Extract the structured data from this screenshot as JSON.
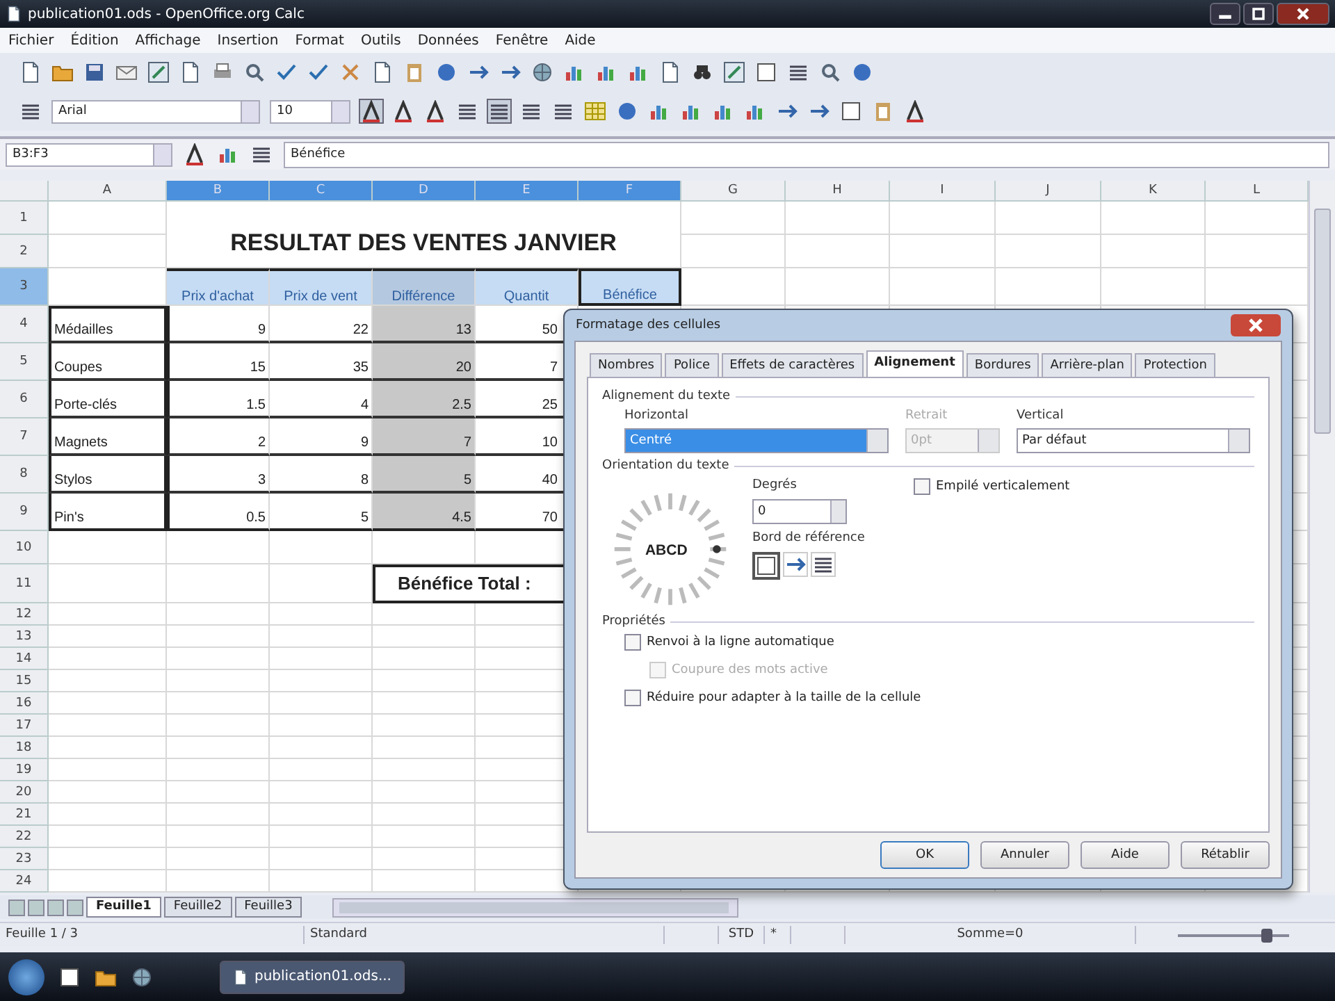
{
  "window": {
    "title": "publication01.ods - OpenOffice.org Calc"
  },
  "menu": [
    "Fichier",
    "Édition",
    "Affichage",
    "Insertion",
    "Format",
    "Outils",
    "Données",
    "Fenêtre",
    "Aide"
  ],
  "format_bar": {
    "font": "Arial",
    "size": "10",
    "bold": true,
    "align_center": true
  },
  "formula_bar": {
    "name_box": "B3:F3",
    "content": "Bénéfice"
  },
  "sheet": {
    "columns": [
      {
        "label": "A",
        "selected": false
      },
      {
        "label": "B",
        "selected": true
      },
      {
        "label": "C",
        "selected": true
      },
      {
        "label": "D",
        "selected": true
      },
      {
        "label": "E",
        "selected": true
      },
      {
        "label": "F",
        "selected": true
      },
      {
        "label": "G",
        "selected": false
      },
      {
        "label": "H",
        "selected": false
      },
      {
        "label": "I",
        "selected": false
      },
      {
        "label": "J",
        "selected": false
      },
      {
        "label": "K",
        "selected": false
      },
      {
        "label": "L",
        "selected": false
      }
    ],
    "rows": [
      {
        "label": "1",
        "selected": false
      },
      {
        "label": "2",
        "selected": false
      },
      {
        "label": "3",
        "selected": true
      },
      {
        "label": "4",
        "selected": false
      },
      {
        "label": "5",
        "selected": false
      },
      {
        "label": "6",
        "selected": false
      },
      {
        "label": "7",
        "selected": false
      },
      {
        "label": "8",
        "selected": false
      },
      {
        "label": "9",
        "selected": false
      },
      {
        "label": "10",
        "selected": false
      },
      {
        "label": "11",
        "selected": false
      },
      {
        "label": "12",
        "selected": false
      },
      {
        "label": "13",
        "selected": false
      },
      {
        "label": "14",
        "selected": false
      },
      {
        "label": "15",
        "selected": false
      },
      {
        "label": "16",
        "selected": false
      },
      {
        "label": "17",
        "selected": false
      },
      {
        "label": "18",
        "selected": false
      },
      {
        "label": "19",
        "selected": false
      },
      {
        "label": "20",
        "selected": false
      },
      {
        "label": "21",
        "selected": false
      },
      {
        "label": "22",
        "selected": false
      },
      {
        "label": "23",
        "selected": false
      },
      {
        "label": "24",
        "selected": false
      }
    ],
    "title": "RESULTAT DES VENTES JANVIER",
    "headers": [
      "Prix d'achat",
      "Prix de vent",
      "Différence",
      "Quantit",
      "Bénéfice"
    ],
    "items": [
      {
        "name": "Médailles",
        "values": [
          "9",
          "22",
          "13",
          "50"
        ]
      },
      {
        "name": "Coupes",
        "values": [
          "15",
          "35",
          "20",
          "7"
        ]
      },
      {
        "name": "Porte-clés",
        "values": [
          "1.5",
          "4",
          "2.5",
          "25"
        ]
      },
      {
        "name": "Magnets",
        "values": [
          "2",
          "9",
          "7",
          "10"
        ]
      },
      {
        "name": "Stylos",
        "values": [
          "3",
          "8",
          "5",
          "40"
        ]
      },
      {
        "name": "Pin's",
        "values": [
          "0.5",
          "5",
          "4.5",
          "70"
        ]
      }
    ],
    "total_label": "Bénéfice Total :"
  },
  "sheet_tabs": [
    {
      "label": "Feuille1",
      "selected": true
    },
    {
      "label": "Feuille2",
      "selected": false
    },
    {
      "label": "Feuille3",
      "selected": false
    }
  ],
  "status_bar": {
    "sheet": "Feuille 1 / 3",
    "style": "Standard",
    "mode": "STD",
    "modified": "*",
    "sum": "Somme=0",
    "zoom": {
      "level": 0.8
    }
  },
  "taskbar": {
    "tasks": [
      {
        "label": "publication01.ods...",
        "selected": true
      }
    ]
  },
  "dialog": {
    "title": "Formatage des cellules",
    "tabs": [
      {
        "label": "Nombres",
        "selected": false
      },
      {
        "label": "Police",
        "selected": false
      },
      {
        "label": "Effets de caractères",
        "selected": false
      },
      {
        "label": "Alignement",
        "selected": true
      },
      {
        "label": "Bordures",
        "selected": false
      },
      {
        "label": "Arrière-plan",
        "selected": false
      },
      {
        "label": "Protection",
        "selected": false
      }
    ],
    "alignment_section": "Alignement du texte",
    "horizontal": {
      "label": "Horizontal",
      "value": "Centré"
    },
    "indent": {
      "label": "Retrait",
      "value": "0pt",
      "disabled": true
    },
    "vertical": {
      "label": "Vertical",
      "value": "Par défaut"
    },
    "orientation_section": "Orientation du texte",
    "dial_text": "ABCD",
    "degrees": {
      "label": "Degrés",
      "value": "0"
    },
    "reference_edge": {
      "label": "Bord de référence",
      "options": [
        {
          "selected": true
        },
        {
          "selected": false
        },
        {
          "selected": false
        }
      ]
    },
    "stacked": {
      "label": "Empilé verticalement",
      "checked": false,
      "disabled": false
    },
    "properties_section": "Propriétés",
    "properties": [
      {
        "label": "Renvoi à la ligne automatique",
        "checked": false,
        "disabled": false,
        "indented": false
      },
      {
        "label": "Coupure des mots active",
        "checked": false,
        "disabled": true,
        "indented": true
      },
      {
        "label": "Réduire pour adapter à la taille de la cellule",
        "checked": false,
        "disabled": false,
        "indented": false
      }
    ],
    "buttons": [
      {
        "label": "OK",
        "default": true
      },
      {
        "label": "Annuler",
        "default": false
      },
      {
        "label": "Aide",
        "default": false
      },
      {
        "label": "Rétablir",
        "default": false
      }
    ]
  }
}
